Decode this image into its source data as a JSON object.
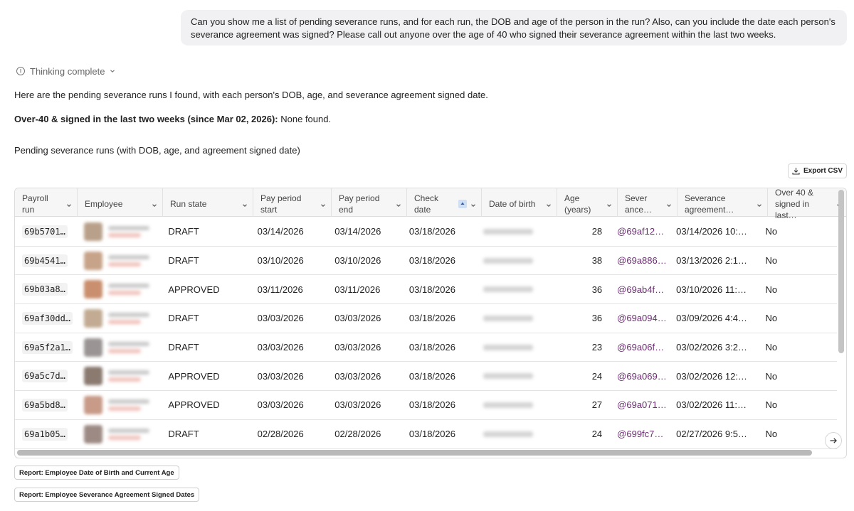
{
  "user_message": "Can you show me a list of pending severance runs, and for each run, the DOB and age of the person in the run? Also, can you include the date each person's severance agreement was signed? Please call out anyone over the age of 40 who signed their severance agreement within the last two weeks.",
  "thinking": {
    "label": "Thinking complete",
    "icon": "lightbulb-icon"
  },
  "intro": "Here are the pending severance runs I found, with each person's DOB, age, and severance agreement signed date.",
  "callout": {
    "bold": "Over-40 & signed in the last two weeks (since Mar 02, 2026):",
    "rest": " None found."
  },
  "subhead": "Pending severance runs (with DOB, age, and agreement signed date)",
  "export_label": "Export CSV",
  "columns": [
    {
      "label": "Payroll run"
    },
    {
      "label": "Employee"
    },
    {
      "label": "Run state"
    },
    {
      "label": "Pay period start"
    },
    {
      "label": "Pay period end"
    },
    {
      "label": "Check date",
      "sorted": true
    },
    {
      "label": "Date of birth"
    },
    {
      "label": "Age (years)"
    },
    {
      "label": "Sever ance…"
    },
    {
      "label": "Severance agreement…"
    },
    {
      "label": "Over 40 & signed in last…"
    }
  ],
  "rows": [
    {
      "run": "69b5701…",
      "state": "DRAFT",
      "start": "03/14/2026",
      "end": "03/14/2026",
      "check": "03/18/2026",
      "age": "28",
      "severance": "@69af12…",
      "signed": "03/14/2026 10:…",
      "flag": "No",
      "avatar_color": "#b9a08a"
    },
    {
      "run": "69b4541…",
      "state": "DRAFT",
      "start": "03/10/2026",
      "end": "03/10/2026",
      "check": "03/18/2026",
      "age": "38",
      "severance": "@69a886…",
      "signed": "03/13/2026 2:1…",
      "flag": "No",
      "avatar_color": "#c7a389"
    },
    {
      "run": "69b03a8…",
      "state": "APPROVED",
      "start": "03/11/2026",
      "end": "03/11/2026",
      "check": "03/18/2026",
      "age": "36",
      "severance": "@69ab4f…",
      "signed": "03/10/2026 11:…",
      "flag": "No",
      "avatar_color": "#c98f6e"
    },
    {
      "run": "69af30dd…",
      "state": "DRAFT",
      "start": "03/03/2026",
      "end": "03/03/2026",
      "check": "03/18/2026",
      "age": "36",
      "severance": "@69a094…",
      "signed": "03/09/2026 4:4…",
      "flag": "No",
      "avatar_color": "#c2ab92"
    },
    {
      "run": "69a5f2a1…",
      "state": "DRAFT",
      "start": "03/03/2026",
      "end": "03/03/2026",
      "check": "03/18/2026",
      "age": "23",
      "severance": "@69a06f…",
      "signed": "03/02/2026 3:2…",
      "flag": "No",
      "avatar_color": "#9a9494"
    },
    {
      "run": "69a5c7d…",
      "state": "APPROVED",
      "start": "03/03/2026",
      "end": "03/03/2026",
      "check": "03/18/2026",
      "age": "24",
      "severance": "@69a069…",
      "signed": "03/02/2026 12:…",
      "flag": "No",
      "avatar_color": "#8a7a70"
    },
    {
      "run": "69a5bd8…",
      "state": "APPROVED",
      "start": "03/03/2026",
      "end": "03/03/2026",
      "check": "03/18/2026",
      "age": "27",
      "severance": "@69a071…",
      "signed": "03/02/2026 11:…",
      "flag": "No",
      "avatar_color": "#c89a88"
    },
    {
      "run": "69a1b05…",
      "state": "DRAFT",
      "start": "02/28/2026",
      "end": "02/28/2026",
      "check": "03/18/2026",
      "age": "24",
      "severance": "@699fc7…",
      "signed": "02/27/2026 9:5…",
      "flag": "No",
      "avatar_color": "#9d8a84"
    }
  ],
  "reports": [
    "Report: Employee Date of Birth and Current Age",
    "Report: Employee Severance Agreement Signed Dates"
  ]
}
